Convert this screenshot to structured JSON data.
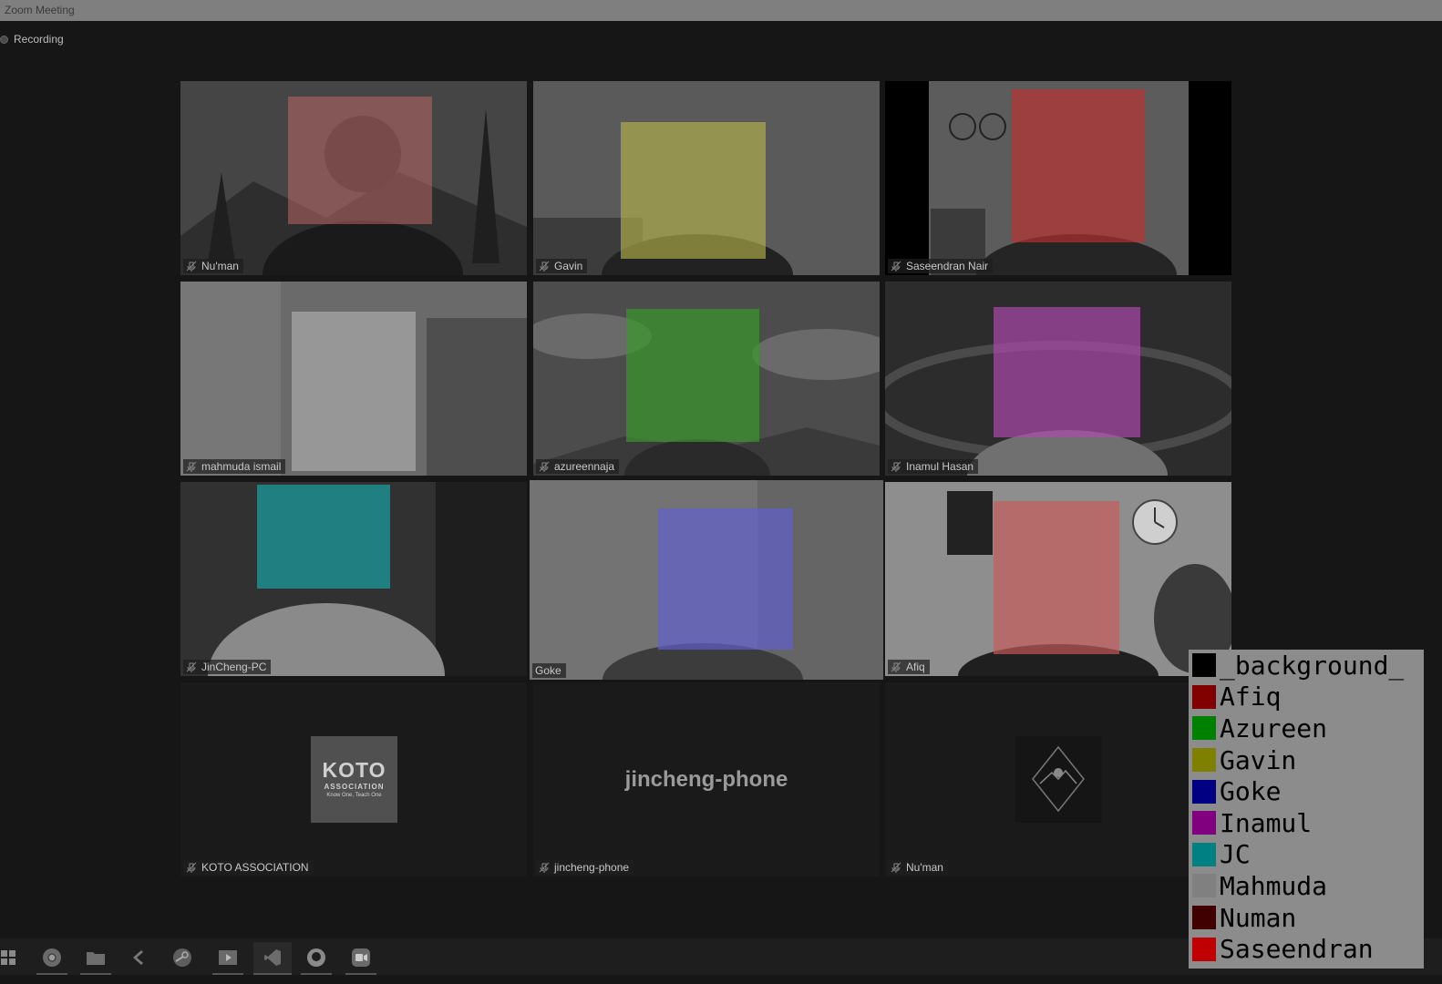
{
  "window": {
    "title": "Zoom Meeting"
  },
  "recording": {
    "label": "Recording"
  },
  "participants": [
    {
      "name": "Nu'man",
      "face_color": "#c46a6a"
    },
    {
      "name": "Gavin",
      "face_color": "#b5b54a"
    },
    {
      "name": "Saseendran Nair",
      "face_color": "#c43030"
    },
    {
      "name": "mahmuda ismail",
      "face_color": "#a9a9a9"
    },
    {
      "name": "azureennaja",
      "face_color": "#3a9b2a"
    },
    {
      "name": "Inamul Hasan",
      "face_color": "#b04ab0"
    },
    {
      "name": "JinCheng-PC",
      "face_color": "#1a9ea0"
    },
    {
      "name": "Goke",
      "face_color": "#6060d0"
    },
    {
      "name": "Afiq",
      "face_color": "#c95a5a"
    },
    {
      "name": "KOTO ASSOCIATION",
      "logo_title": "KOTO",
      "logo_subtitle": "ASSOCIATION",
      "logo_tagline": "Know One, Teach One"
    },
    {
      "name": "jincheng-phone",
      "display_text": "jincheng-phone"
    },
    {
      "name": "Nu'man",
      "logo": "mountain-diamond-logo"
    }
  ],
  "legend": [
    {
      "label": "_background_",
      "color": "#000000"
    },
    {
      "label": "Afiq",
      "color": "#800000"
    },
    {
      "label": "Azureen",
      "color": "#008000"
    },
    {
      "label": "Gavin",
      "color": "#808000"
    },
    {
      "label": "Goke",
      "color": "#000080"
    },
    {
      "label": "Inamul",
      "color": "#800080"
    },
    {
      "label": "JC",
      "color": "#008080"
    },
    {
      "label": "Mahmuda",
      "color": "#808080"
    },
    {
      "label": "Numan",
      "color": "#400000"
    },
    {
      "label": "Saseendran",
      "color": "#c00000"
    }
  ],
  "taskbar": [
    "windows-start-icon",
    "chrome-icon",
    "file-explorer-icon",
    "vscode-icon",
    "steam-icon",
    "media-player-icon",
    "visual-studio-icon",
    "github-icon",
    "zoom-icon"
  ]
}
